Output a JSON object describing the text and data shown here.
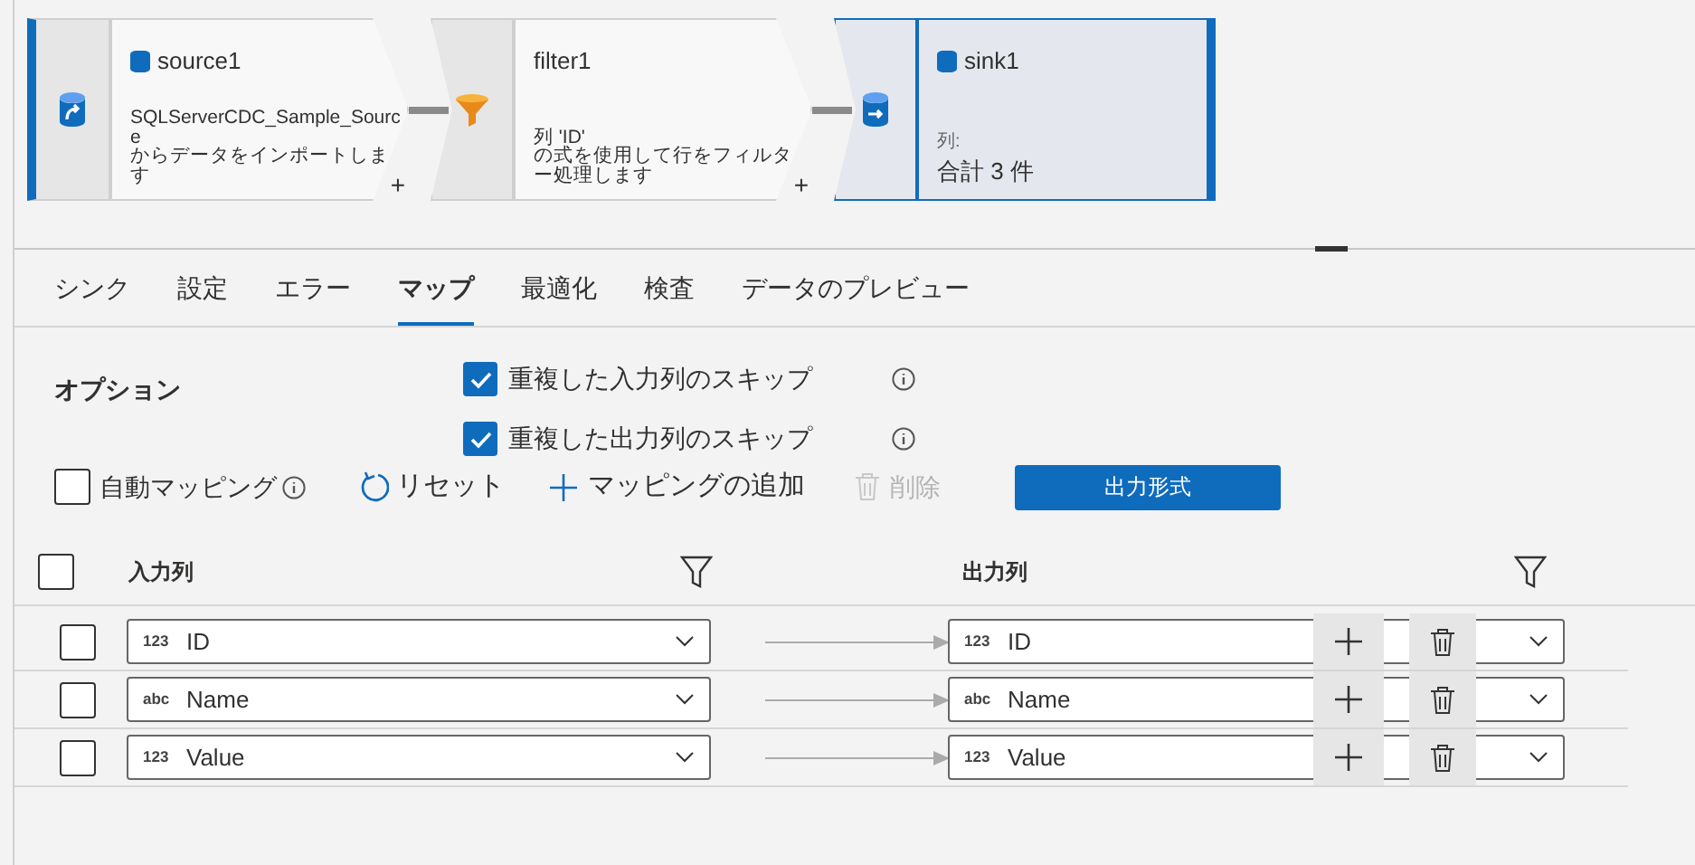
{
  "pipeline": {
    "nodes": [
      {
        "kind": "source",
        "title": "source1",
        "lines": [
          "SQLServerCDC_Sample_Sourc",
          "e",
          "からデータをインポートしま",
          "す"
        ],
        "selected": false,
        "plus": "+"
      },
      {
        "kind": "filter",
        "title": "filter1",
        "lines": [
          "列 'ID'",
          "の式を使用して行をフィルタ",
          "ー処理します"
        ],
        "selected": false,
        "plus": "+"
      },
      {
        "kind": "sink",
        "title": "sink1",
        "caption": "列:",
        "lines": [
          "合計 3 件"
        ],
        "selected": true
      }
    ]
  },
  "tabs": [
    {
      "label": "シンク",
      "selected": false
    },
    {
      "label": "設定",
      "selected": false
    },
    {
      "label": "エラー",
      "selected": false
    },
    {
      "label": "マップ",
      "selected": true
    },
    {
      "label": "最適化",
      "selected": false
    },
    {
      "label": "検査",
      "selected": false
    },
    {
      "label": "データのプレビュー",
      "selected": false
    }
  ],
  "options": {
    "label": "オプション",
    "items": [
      {
        "label": "重複した入力列のスキップ",
        "checked": true
      },
      {
        "label": "重複した出力列のスキップ",
        "checked": true
      }
    ]
  },
  "toolbar": {
    "auto_mapping": {
      "label": "自動マッピング",
      "checked": false
    },
    "reset": "リセット",
    "add_mapping": "マッピングの追加",
    "delete": {
      "label": "削除",
      "disabled": true
    },
    "output_format": "出力形式"
  },
  "table": {
    "select_all": false,
    "columns": [
      "入力列",
      "出力列"
    ],
    "rows": [
      {
        "checked": false,
        "input": {
          "type": "123",
          "name": "ID"
        },
        "output": {
          "type": "123",
          "name": "ID"
        }
      },
      {
        "checked": false,
        "input": {
          "type": "abc",
          "name": "Name"
        },
        "output": {
          "type": "abc",
          "name": "Name"
        }
      },
      {
        "checked": false,
        "input": {
          "type": "123",
          "name": "Value"
        },
        "output": {
          "type": "123",
          "name": "Value"
        }
      }
    ]
  }
}
